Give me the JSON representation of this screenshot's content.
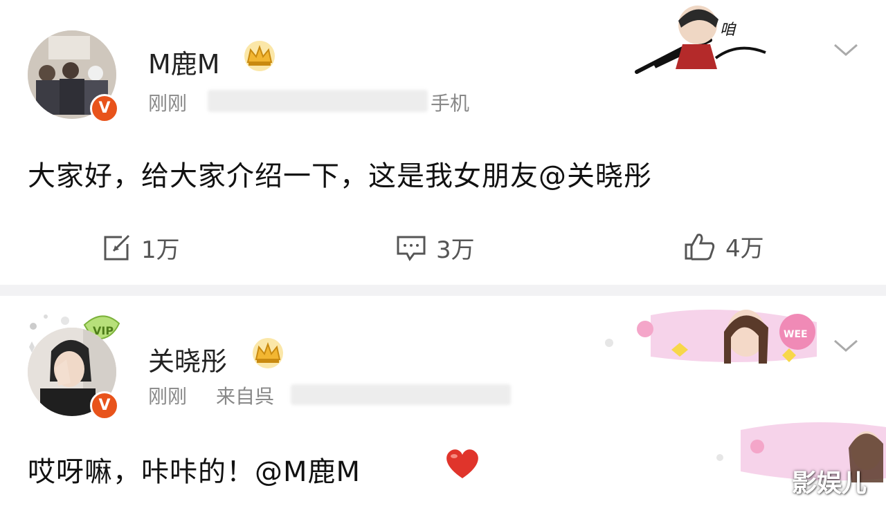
{
  "posts": [
    {
      "username": "M鹿M",
      "time": "刚刚",
      "source": "手机",
      "text": "大家好，给大家介绍一下，这是我女朋友@关晓彤",
      "repost_count": "1万",
      "comment_count": "3万",
      "like_count": "4万",
      "verified_badge": "V"
    },
    {
      "username": "关晓彤",
      "time": "刚刚",
      "source": "来自呉",
      "text": "哎呀嘛，咔咔的！@M鹿M",
      "verified_badge": "V"
    }
  ],
  "watermark": "影娱儿",
  "colors": {
    "badge": "#e8531b",
    "crown": "#f2b632",
    "heart": "#e0342b",
    "meta": "#888888"
  },
  "icons": [
    "crown-icon",
    "chevron-down-icon",
    "repost-icon",
    "comment-icon",
    "like-icon",
    "heart-icon",
    "verified-icon"
  ]
}
